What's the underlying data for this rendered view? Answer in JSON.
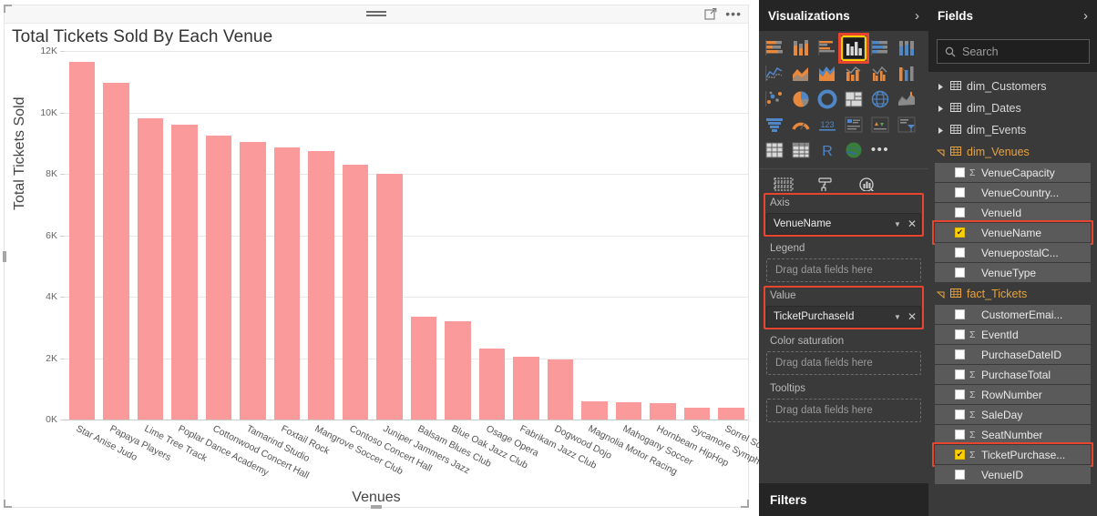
{
  "report": {
    "chart_title": "Total Tickets Sold By Each Venue",
    "focus_icon": "focus-mode-icon",
    "more_icon": "more-options-icon",
    "more_label": "•••",
    "drag_handle_icon": "drag-handle-icon"
  },
  "chart_data": {
    "type": "bar",
    "title": "Total Tickets Sold By Each Venue",
    "xlabel": "Venues",
    "ylabel": "Total Tickets Sold",
    "ylim": [
      0,
      12000
    ],
    "yticks": [
      0,
      2000,
      4000,
      6000,
      8000,
      10000,
      12000
    ],
    "ytick_labels": [
      "0K",
      "2K",
      "4K",
      "6K",
      "8K",
      "10K",
      "12K"
    ],
    "grid": true,
    "legend": "none",
    "bar_color": "#fb9a9a",
    "categories": [
      "Star Anise Judo",
      "Papaya Players",
      "Lime Tree Track",
      "Poplar Dance Academy",
      "Cottonwood Concert Hall",
      "Tamarind Studio",
      "Foxtail Rock",
      "Mangrove Soccer Club",
      "Contoso Concert Hall",
      "Juniper Jammers Jazz",
      "Balsam Blues Club",
      "Blue Oak Jazz Club",
      "Osage Opera",
      "Fabrikam Jazz Club",
      "Dogwood Dojo",
      "Magnolia Motor Racing",
      "Mahogany Soccer",
      "Hornbeam HipHop",
      "Sycamore Symphony",
      "Sorrel Soccer"
    ],
    "values": [
      11650,
      10950,
      9800,
      9600,
      9250,
      9050,
      8850,
      8750,
      8300,
      8000,
      3350,
      3200,
      2300,
      2050,
      1950,
      600,
      550,
      520,
      400,
      380
    ]
  },
  "visualizations": {
    "title": "Visualizations",
    "expand_icon": "chevron-right-icon",
    "gallery": [
      [
        {
          "icon": "stacked-bar-chart-icon",
          "selected": false
        },
        {
          "icon": "stacked-column-chart-icon",
          "selected": false
        },
        {
          "icon": "clustered-bar-chart-icon",
          "selected": false
        },
        {
          "icon": "clustered-column-chart-icon",
          "selected": true
        },
        {
          "icon": "100-percent-stacked-bar-chart-icon",
          "selected": false
        },
        {
          "icon": "100-percent-stacked-column-chart-icon",
          "selected": false
        }
      ],
      [
        {
          "icon": "line-chart-icon",
          "selected": false
        },
        {
          "icon": "area-chart-icon",
          "selected": false
        },
        {
          "icon": "stacked-area-chart-icon",
          "selected": false
        },
        {
          "icon": "line-and-stacked-column-chart-icon",
          "selected": false
        },
        {
          "icon": "line-and-clustered-column-chart-icon",
          "selected": false
        },
        {
          "icon": "ribbon-chart-icon",
          "selected": false
        }
      ],
      [
        {
          "icon": "scatter-chart-icon",
          "selected": false
        },
        {
          "icon": "pie-chart-icon",
          "selected": false
        },
        {
          "icon": "donut-chart-icon",
          "selected": false
        },
        {
          "icon": "treemap-icon",
          "selected": false
        },
        {
          "icon": "map-icon",
          "selected": false
        },
        {
          "icon": "filled-map-icon",
          "selected": false
        }
      ],
      [
        {
          "icon": "funnel-chart-icon",
          "selected": false
        },
        {
          "icon": "gauge-chart-icon",
          "selected": false
        },
        {
          "icon": "card-icon",
          "selected": false
        },
        {
          "icon": "multi-row-card-icon",
          "selected": false
        },
        {
          "icon": "kpi-icon",
          "selected": false
        },
        {
          "icon": "slicer-icon",
          "selected": false
        }
      ],
      [
        {
          "icon": "table-icon",
          "selected": false
        },
        {
          "icon": "matrix-icon",
          "selected": false
        },
        {
          "icon": "r-script-visual-icon",
          "selected": false
        },
        {
          "icon": "arcgis-map-icon",
          "selected": false
        },
        {
          "icon": "more-visuals-icon",
          "selected": false
        }
      ]
    ],
    "gallery_more_label": "•••",
    "tabs": [
      {
        "icon": "fields-tab-icon",
        "selected": true
      },
      {
        "icon": "format-paint-roller-tab-icon",
        "selected": false
      },
      {
        "icon": "analytics-magnifier-tab-icon",
        "selected": false
      }
    ],
    "wells": [
      {
        "label": "Axis",
        "filled": true,
        "value": "VenueName",
        "highlighted": true,
        "caret_icon": "chevron-down-icon",
        "remove_icon": "close-icon"
      },
      {
        "label": "Legend",
        "filled": false,
        "placeholder": "Drag data fields here",
        "highlighted": false
      },
      {
        "label": "Value",
        "filled": true,
        "value": "TicketPurchaseId",
        "highlighted": true,
        "caret_icon": "chevron-down-icon",
        "remove_icon": "close-icon"
      },
      {
        "label": "Color saturation",
        "filled": false,
        "placeholder": "Drag data fields here",
        "highlighted": false
      },
      {
        "label": "Tooltips",
        "filled": false,
        "placeholder": "Drag data fields here",
        "highlighted": false
      }
    ],
    "filters_label": "Filters"
  },
  "fields": {
    "title": "Fields",
    "expand_icon": "chevron-right-icon",
    "search": {
      "placeholder": "Search",
      "icon": "search-icon",
      "value": ""
    },
    "tree": [
      {
        "kind": "table",
        "label": "dim_Customers",
        "expanded": false,
        "icon": "table-icon"
      },
      {
        "kind": "table",
        "label": "dim_Dates",
        "expanded": false,
        "icon": "table-icon"
      },
      {
        "kind": "table",
        "label": "dim_Events",
        "expanded": false,
        "icon": "table-icon"
      },
      {
        "kind": "table",
        "label": "dim_Venues",
        "expanded": true,
        "icon": "table-icon"
      },
      {
        "kind": "field",
        "label": "VenueCapacity",
        "checked": false,
        "sigma": true,
        "highlighted": false
      },
      {
        "kind": "field",
        "label": "VenueCountry...",
        "checked": false,
        "sigma": false,
        "highlighted": false
      },
      {
        "kind": "field",
        "label": "VenueId",
        "checked": false,
        "sigma": false,
        "highlighted": false
      },
      {
        "kind": "field",
        "label": "VenueName",
        "checked": true,
        "sigma": false,
        "highlighted": true
      },
      {
        "kind": "field",
        "label": "VenuepostalC...",
        "checked": false,
        "sigma": false,
        "highlighted": false
      },
      {
        "kind": "field",
        "label": "VenueType",
        "checked": false,
        "sigma": false,
        "highlighted": false
      },
      {
        "kind": "table",
        "label": "fact_Tickets",
        "expanded": true,
        "icon": "table-icon"
      },
      {
        "kind": "field",
        "label": "CustomerEmai...",
        "checked": false,
        "sigma": false,
        "highlighted": false
      },
      {
        "kind": "field",
        "label": "EventId",
        "checked": false,
        "sigma": true,
        "highlighted": false
      },
      {
        "kind": "field",
        "label": "PurchaseDateID",
        "checked": false,
        "sigma": false,
        "highlighted": false
      },
      {
        "kind": "field",
        "label": "PurchaseTotal",
        "checked": false,
        "sigma": true,
        "highlighted": false
      },
      {
        "kind": "field",
        "label": "RowNumber",
        "checked": false,
        "sigma": true,
        "highlighted": false
      },
      {
        "kind": "field",
        "label": "SaleDay",
        "checked": false,
        "sigma": true,
        "highlighted": false
      },
      {
        "kind": "field",
        "label": "SeatNumber",
        "checked": false,
        "sigma": true,
        "highlighted": false
      },
      {
        "kind": "field",
        "label": "TicketPurchase...",
        "checked": true,
        "sigma": true,
        "highlighted": true
      },
      {
        "kind": "field",
        "label": "VenueID",
        "checked": false,
        "sigma": false,
        "highlighted": false
      }
    ]
  },
  "colors": {
    "bar": "#fb9a9a",
    "accent_yellow": "#ffd000",
    "highlight_red": "#e8442e",
    "pane_bg": "#3a3a3a",
    "pane_header_bg": "#252525",
    "table_expanded": "#e8a33d"
  }
}
